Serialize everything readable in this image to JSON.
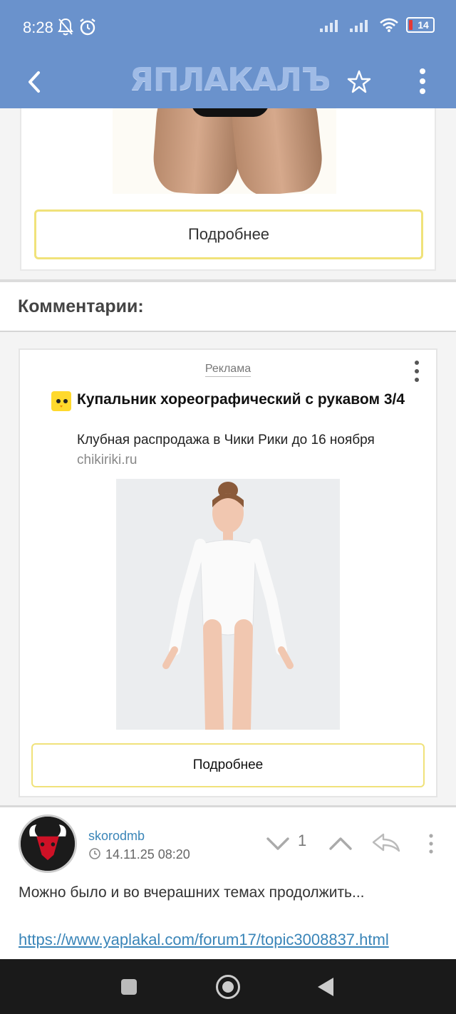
{
  "status_bar": {
    "time": "8:28",
    "battery_level": "14",
    "icons": [
      "notifications-off-icon",
      "alarm-icon",
      "signal-icon",
      "signal-icon",
      "wifi-icon",
      "battery-icon"
    ]
  },
  "app_bar": {
    "logo_text": "ЯПЛАКАЛЪ",
    "back_icon": "back-arrow-icon",
    "star_icon": "star-icon",
    "more_icon": "more-vertical-icon"
  },
  "top_post": {
    "more_button_label": "Подробнее"
  },
  "comments": {
    "title": "Комментарии:"
  },
  "ad": {
    "label": "Реклама",
    "title": "Купальник хореографический с рукавом 3/4",
    "description": "Клубная распродажа в Чики Рики до 16 ноября",
    "domain": "chikiriki.ru",
    "button_label": "Подробнее"
  },
  "comment": {
    "username": "skorodmb",
    "timestamp": "14.11.25 08:20",
    "votes": "1",
    "text": "Можно было и во вчерашних темах продолжить...",
    "link": "https://www.yaplakal.com/forum17/topic3008837.html"
  },
  "colors": {
    "header": "#6a92cc",
    "link": "#3a85b8",
    "button_border": "#f0e27a"
  }
}
